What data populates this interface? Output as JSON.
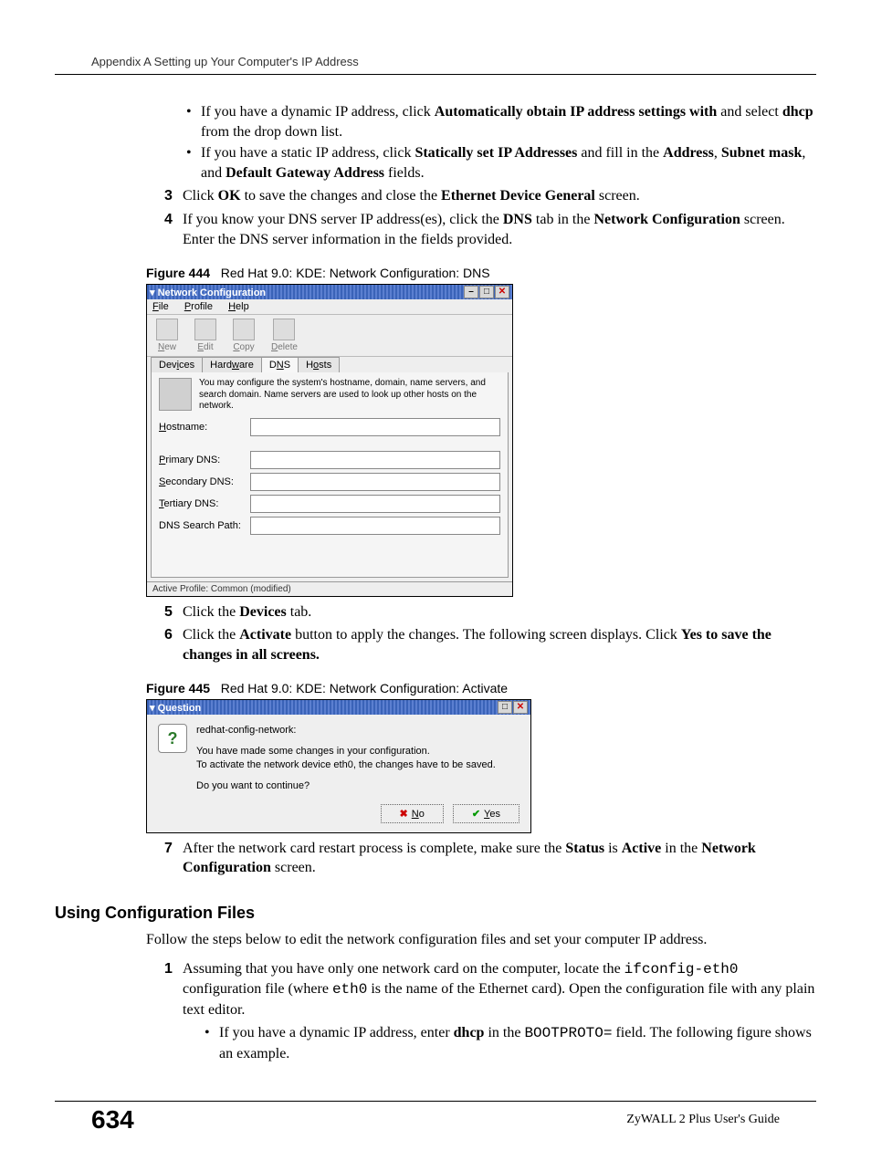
{
  "header": "Appendix A Setting up Your Computer's IP Address",
  "bullets_top": [
    {
      "pre": "If you have a dynamic IP address, click ",
      "b1": "Automatically obtain IP address settings with",
      "mid": " and select ",
      "b2": "dhcp",
      "post": " from the drop down list."
    },
    {
      "pre": "If you have a static IP address, click ",
      "b1": "Statically set IP Addresses",
      "mid": " and fill in the ",
      "b2": "Address",
      "mid2": ", ",
      "b3": "Subnet mask",
      "mid3": ", and ",
      "b4": "Default Gateway Address",
      "post": " fields."
    }
  ],
  "step3": {
    "num": "3",
    "pre": "Click ",
    "b1": "OK",
    "mid": " to save the changes and close the ",
    "b2": "Ethernet Device General",
    "post": " screen."
  },
  "step4": {
    "num": "4",
    "pre": "If you know your DNS server IP address(es), click the ",
    "b1": "DNS",
    "mid": " tab in the ",
    "b2": "Network Configuration",
    "post": " screen. Enter the DNS server information in the fields provided."
  },
  "fig444": {
    "num": "Figure 444",
    "caption": "Red Hat 9.0: KDE: Network Configuration: DNS"
  },
  "dnswin": {
    "title": "Network Configuration",
    "menu": [
      "File",
      "Profile",
      "Help"
    ],
    "menu_acc": [
      "F",
      "P",
      "H"
    ],
    "toolbar": [
      "New",
      "Edit",
      "Copy",
      "Delete"
    ],
    "toolbar_acc": [
      "N",
      "E",
      "C",
      "D"
    ],
    "tabs": [
      "Devices",
      "Hardware",
      "DNS",
      "Hosts"
    ],
    "tabs_acc": [
      "i",
      "w",
      "N",
      "o"
    ],
    "active_tab": "DNS",
    "desc": "You may configure the system's hostname, domain, name servers, and search domain. Name servers are used to look up other hosts on the network.",
    "rows": [
      {
        "label": "Hostname:",
        "acc": "H"
      },
      {
        "label": "Primary DNS:",
        "acc": "P"
      },
      {
        "label": "Secondary DNS:",
        "acc": "S"
      },
      {
        "label": "Tertiary DNS:",
        "acc": "T"
      },
      {
        "label": "DNS Search Path:",
        "acc": ""
      }
    ],
    "status": "Active Profile: Common (modified)"
  },
  "step5": {
    "num": "5",
    "pre": "Click the ",
    "b1": "Devices",
    "post": " tab."
  },
  "step6": {
    "num": "6",
    "pre": "Click the ",
    "b1": "Activate",
    "mid": " button to apply the changes. The following screen displays. Click ",
    "b2": "Yes to save the changes in all screens.",
    "post": ""
  },
  "fig445": {
    "num": "Figure 445",
    "caption": "Red Hat 9.0: KDE: Network Configuration: Activate"
  },
  "actdlg": {
    "title": "Question",
    "line1": "redhat-config-network:",
    "line2": "You have made some changes in your configuration.",
    "line3": "To activate the network device eth0, the changes have to be saved.",
    "line4": "Do you want to continue?",
    "no": "No",
    "no_acc": "N",
    "yes": "Yes",
    "yes_acc": "Y"
  },
  "step7": {
    "num": "7",
    "pre": "After the network card restart process is complete, make sure the ",
    "b1": "Status",
    "mid": " is ",
    "b2": "Active",
    "mid2": " in the ",
    "b3": "Network Configuration",
    "post": " screen."
  },
  "sectionHead": "Using Configuration Files",
  "sectionIntro": "Follow the steps below to edit the network configuration files and set your computer IP address.",
  "cfgstep1": {
    "num": "1",
    "t1": "Assuming that you have only one network card on the computer, locate the ",
    "m1": "ifconfig-eth0",
    "t2": " configuration file (where ",
    "m2": "eth0",
    "t3": " is the name of the Ethernet card). Open the configuration file with any plain text editor."
  },
  "cfgbullet": {
    "pre": "If you have a dynamic IP address, enter ",
    "b1": "dhcp",
    "mid": " in the ",
    "m1": "BOOTPROTO=",
    "post": " field.  The following figure shows an example."
  },
  "footer": {
    "page": "634",
    "guide": "ZyWALL 2 Plus User's Guide"
  }
}
